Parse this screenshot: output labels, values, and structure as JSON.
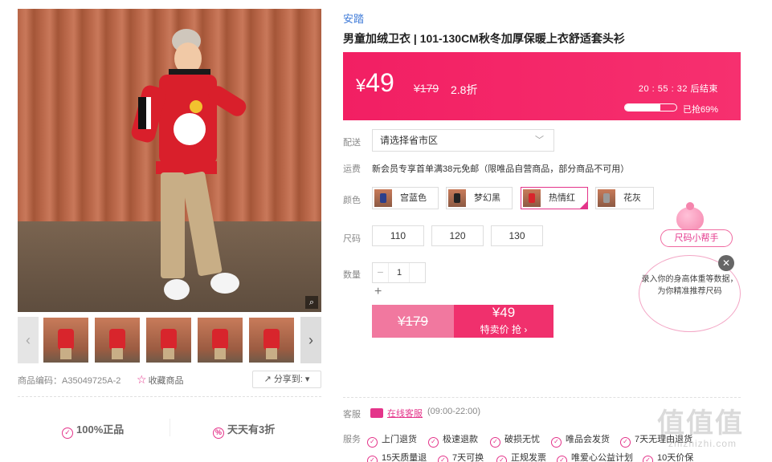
{
  "product": {
    "brand": "安踏",
    "title": "男童加绒卫衣 | 101-130CM秋冬加厚保暖上衣舒适套头衫",
    "sku_label": "商品编码：A35049725A-2",
    "favorite_label": "收藏商品",
    "share_label": "分享到:",
    "guarantee_authentic": "100%正品",
    "guarantee_discount": "天天有3折"
  },
  "price": {
    "currency": "¥",
    "sale": "49",
    "original": "¥179",
    "discount": "2.8折",
    "countdown": "20 : 55 : 32  后结束",
    "sold_progress": 0.69,
    "sold_text": "已抢69%"
  },
  "delivery": {
    "label": "配送",
    "placeholder": "请选择省市区"
  },
  "shipping": {
    "label": "运费",
    "text": "新会员专享首单满38元免邮（限唯品自营商品，部分商品不可用）"
  },
  "colors": {
    "label": "颜色",
    "options": [
      {
        "name": "宫蓝色",
        "swatch": "#2b3f8c"
      },
      {
        "name": "梦幻黑",
        "swatch": "#222222"
      },
      {
        "name": "热情红",
        "swatch": "#d8252c",
        "selected": true
      },
      {
        "name": "花灰",
        "swatch": "#9a9a9a"
      }
    ]
  },
  "sizes": {
    "label": "尺码",
    "options": [
      "110",
      "120",
      "130"
    ]
  },
  "quantity": {
    "label": "数量",
    "value": "1"
  },
  "buy": {
    "original": "¥179",
    "price": "¥49",
    "cta": "特卖价 抢 ›"
  },
  "size_helper": {
    "tag": "尺码小帮手",
    "text": "录入你的身高体重等数据，为你精准推荐尺码"
  },
  "customer_service": {
    "label": "客服",
    "link": "在线客服",
    "hours": "(09:00-22:00)"
  },
  "services": {
    "label": "服务",
    "row1": [
      "上门退货",
      "极速退款",
      "破损无忧",
      "唯品会发货",
      "7天无理由退货"
    ],
    "row2": [
      "15天质量退",
      "7天可换",
      "正规发票",
      "唯爱心公益计划",
      "10天价保"
    ]
  },
  "watermark": {
    "main": "值值值",
    "url": "zhizhizhi.com"
  },
  "colors_theme": {
    "accent": "#f0306d",
    "link": "#3f7bd8"
  }
}
